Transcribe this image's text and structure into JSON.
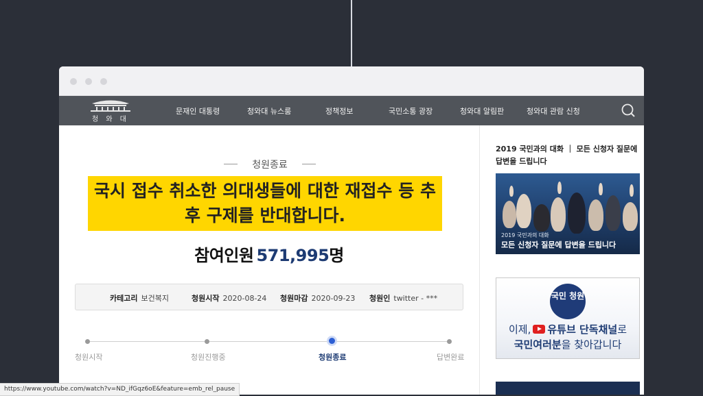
{
  "nav": {
    "logo_text": "청 와 대",
    "items": [
      "문재인 대통령",
      "청와대 뉴스룸",
      "정책정보",
      "국민소통 광장",
      "청와대 알림판",
      "청와대 관람 신청"
    ]
  },
  "petition": {
    "status": "청원종료",
    "title": "국시 접수 취소한 의대생들에 대한 재접수 등 추후 구제를 반대합니다.",
    "count_label": "참여인원",
    "count_value": "571,995",
    "count_unit": "명",
    "info": {
      "category_key": "카테고리",
      "category_val": "보건복지",
      "start_key": "청원시작",
      "start_val": "2020-08-24",
      "end_key": "청원마감",
      "end_val": "2020-09-23",
      "author_key": "청원인",
      "author_val": "twitter - ***"
    },
    "progress": [
      "청원시작",
      "청원진행중",
      "청원종료",
      "답변완료"
    ],
    "progress_active_index": 2
  },
  "side": {
    "headline": "2019 국민과의 대화 ｜ 모든 신청자 질문에 답변을 드립니다",
    "banner1_caption_small": "2019 국민과의 대화",
    "banner1_caption_big": "모든 신청자 질문에 답변을 드립니다",
    "banner2_badge": "국민 청원",
    "banner2_line1_a": "이제,",
    "banner2_line1_b": "유튜브 단독채널",
    "banner2_line1_c": "로",
    "banner2_line2_a": "국민여러분",
    "banner2_line2_b": "을 찾아갑니다"
  },
  "status_url": "https://www.youtube.com/watch?v=ND_ifGqz6oE&feature=emb_rel_pause",
  "colors": {
    "highlight": "#ffd600",
    "accent": "#1d3b73",
    "nav_bg": "#50545a"
  }
}
